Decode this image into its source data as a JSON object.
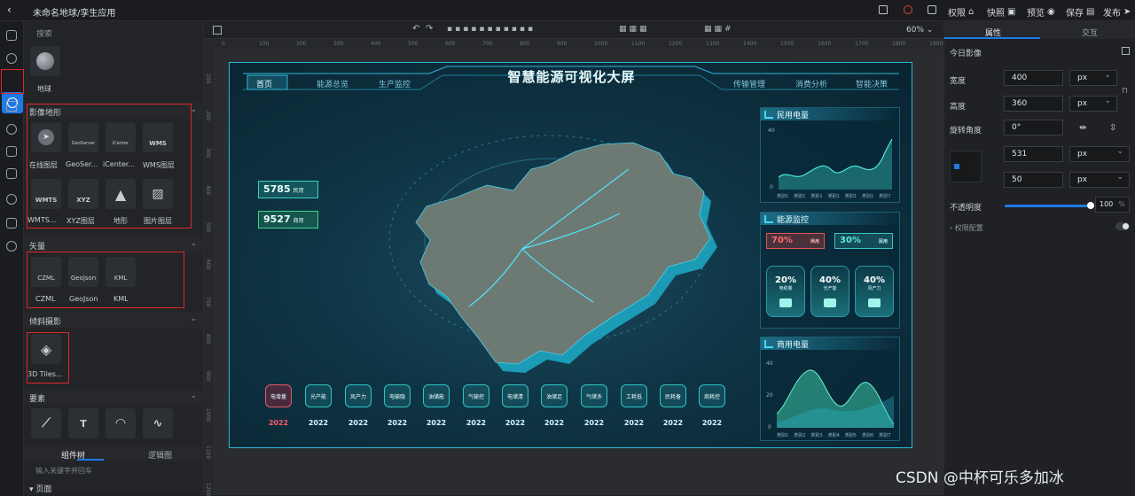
{
  "app": {
    "title": "未命名地球/孪生应用"
  },
  "topbar": {
    "items": [
      {
        "label": "权限",
        "icon": "lock-icon"
      },
      {
        "label": "快照",
        "icon": "camera-icon"
      },
      {
        "label": "预览",
        "icon": "eye-icon"
      },
      {
        "label": "保存",
        "icon": "save-icon"
      },
      {
        "label": "发布",
        "icon": "send-icon"
      }
    ]
  },
  "left_panel": {
    "search_label": "搜索",
    "globe": {
      "label": "地球"
    },
    "sections": {
      "imagery": {
        "title": "影像地形",
        "items": [
          {
            "label": "在线图层",
            "tile": ""
          },
          {
            "label": "GeoSer...",
            "tile": "GeoServer"
          },
          {
            "label": "iCenter...",
            "tile": "iCenter"
          },
          {
            "label": "WMS图层",
            "tile": "WMS"
          },
          {
            "label": "WMTS...",
            "tile": "WMTS"
          },
          {
            "label": "XYZ图层",
            "tile": "XYZ"
          },
          {
            "label": "地形",
            "tile": ""
          },
          {
            "label": "图片图层",
            "tile": ""
          }
        ]
      },
      "vector": {
        "title": "矢量",
        "items": [
          {
            "label": "CZML",
            "tile": "CZML"
          },
          {
            "label": "GeoJson",
            "tile": "Geojson"
          },
          {
            "label": "KML",
            "tile": "KML"
          }
        ]
      },
      "oblique": {
        "title": "倾斜摄影",
        "items": [
          {
            "label": "3D Tiles..."
          }
        ]
      },
      "elements": {
        "title": "要素"
      }
    },
    "tabs": [
      "组件树",
      "逻辑图"
    ],
    "tree_search_placeholder": "输入关键字并回车",
    "tree_root": "页面"
  },
  "canvas": {
    "zoom": "60%",
    "ruler_h": [
      "0",
      "100",
      "200",
      "300",
      "400",
      "500",
      "600",
      "700",
      "800",
      "900",
      "1000",
      "1100",
      "1200",
      "1300",
      "1400",
      "1500",
      "1600",
      "1700",
      "1800",
      "1900"
    ],
    "ruler_v": [
      "100",
      "200",
      "300",
      "400",
      "500",
      "600",
      "700",
      "800",
      "900",
      "1000",
      "1100",
      "1200"
    ]
  },
  "dashboard": {
    "title": "智慧能源可视化大屏",
    "nav_left": [
      "首页",
      "能源总览",
      "生产监控"
    ],
    "nav_right": [
      "传输管理",
      "消费分析",
      "智能决策"
    ],
    "kpis": [
      {
        "value": "5785",
        "unit": "民用"
      },
      {
        "value": "9527",
        "unit": "商用"
      }
    ],
    "panels": {
      "civil": {
        "title": "民用电量",
        "y_zero": "0",
        "y_top": "40",
        "x_labels": [
          "类别1",
          "类别1",
          "类别1",
          "类别1",
          "类别1",
          "类别1",
          "类别7"
        ]
      },
      "energy": {
        "title": "能源监控",
        "ratio_red": {
          "value": "70%",
          "label": "商用"
        },
        "ratio_teal": {
          "value": "30%",
          "label": "民用"
        },
        "stats": [
          {
            "value": "20%",
            "label": "电缆量"
          },
          {
            "value": "40%",
            "label": "光产能"
          },
          {
            "value": "40%",
            "label": "风产力"
          }
        ]
      },
      "commercial": {
        "title": "商用电量",
        "y": [
          "40",
          "20",
          "0"
        ],
        "x_labels": [
          "类别1",
          "类别2",
          "类别3",
          "类别4",
          "类别5",
          "类别6",
          "类别7"
        ]
      }
    },
    "timeline": [
      {
        "label": "电增量",
        "year": "2022",
        "active": true
      },
      {
        "label": "光产能",
        "year": "2022"
      },
      {
        "label": "风产力",
        "year": "2022"
      },
      {
        "label": "电输隐",
        "year": "2022"
      },
      {
        "label": "油储能",
        "year": "2022"
      },
      {
        "label": "气输控",
        "year": "2022"
      },
      {
        "label": "电储清",
        "year": "2022"
      },
      {
        "label": "油储足",
        "year": "2022"
      },
      {
        "label": "气储多",
        "year": "2022"
      },
      {
        "label": "工耗低",
        "year": "2022"
      },
      {
        "label": "民耗备",
        "year": "2022"
      },
      {
        "label": "商耗控",
        "year": "2022"
      }
    ]
  },
  "right_panel": {
    "tabs": [
      "属性",
      "交互"
    ],
    "section_title": "今日影像",
    "width": {
      "label": "宽度",
      "value": "400",
      "unit": "px"
    },
    "height": {
      "label": "高度",
      "value": "360",
      "unit": "px"
    },
    "rotation": {
      "label": "旋转角度",
      "value": "0°"
    },
    "x": {
      "value": "531",
      "unit": "px"
    },
    "y": {
      "value": "50",
      "unit": "px"
    },
    "opacity": {
      "label": "不透明度",
      "value": "100",
      "unit": "%"
    },
    "permission": {
      "label": "权限配置"
    }
  },
  "watermark": "CSDN @中杯可乐多加冰"
}
